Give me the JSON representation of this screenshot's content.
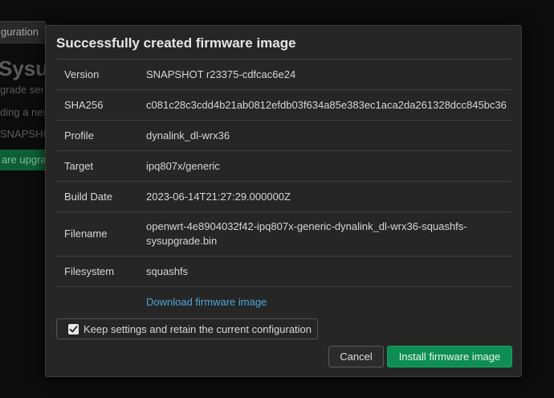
{
  "background": {
    "tab_label": "guration",
    "heading": "Sysup",
    "lines": [
      "grade ser",
      "ding a new",
      "SNAPSHOT"
    ],
    "button_label": "are upgrad"
  },
  "modal": {
    "title": "Successfully created firmware image",
    "rows": [
      {
        "key": "Version",
        "value": "SNAPSHOT r23375-cdfcac6e24"
      },
      {
        "key": "SHA256",
        "value": "c081c28c3cdd4b21ab0812efdb03f634a85e383ec1aca2da261328dcc845bc36"
      },
      {
        "key": "Profile",
        "value": "dynalink_dl-wrx36"
      },
      {
        "key": "Target",
        "value": "ipq807x/generic"
      },
      {
        "key": "Build Date",
        "value": "2023-06-14T21:27:29.000000Z"
      },
      {
        "key": "Filename",
        "value": "openwrt-4e8904032f42-ipq807x-generic-dynalink_dl-wrx36-squashfs-sysupgrade.bin"
      },
      {
        "key": "Filesystem",
        "value": "squashfs"
      }
    ],
    "download_link": "Download firmware image",
    "keep_settings": {
      "label": "Keep settings and retain the current configuration",
      "checked": true
    },
    "cancel_label": "Cancel",
    "install_label": "Install firmware image"
  },
  "colors": {
    "accent_green": "#0e8e52",
    "link_blue": "#4fa6d6",
    "modal_bg": "#262626"
  }
}
